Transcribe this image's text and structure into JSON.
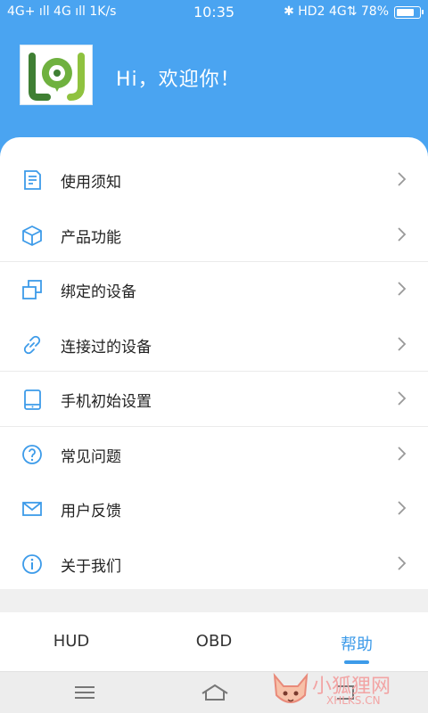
{
  "status_bar": {
    "left": "4G+ ıll 4G ıll 1K/s",
    "time": "10:35",
    "right": "✱ HD2 4G⇅ 78%",
    "battery_percent": 78
  },
  "header": {
    "greeting": "Hi，欢迎你！",
    "logo_icon": "app-logo-icon"
  },
  "menu": [
    {
      "label": "使用须知",
      "icon": "notice-doc-icon"
    },
    {
      "label": "产品功能",
      "icon": "cube-icon"
    },
    {
      "label": "绑定的设备",
      "icon": "bind-device-icon"
    },
    {
      "label": "连接过的设备",
      "icon": "link-icon"
    },
    {
      "label": "手机初始设置",
      "icon": "tablet-icon"
    },
    {
      "label": "常见问题",
      "icon": "question-icon"
    },
    {
      "label": "用户反馈",
      "icon": "mail-icon"
    },
    {
      "label": "关于我们",
      "icon": "info-icon"
    }
  ],
  "tabs": [
    {
      "label": "HUD",
      "active": false
    },
    {
      "label": "OBD",
      "active": false
    },
    {
      "label": "帮助",
      "active": true
    }
  ],
  "nav": {
    "menu_icon": "hamburger-icon",
    "home_icon": "home-icon",
    "back_icon": "back-icon"
  },
  "watermark": {
    "text": "小狐狸网",
    "sub": "XHLKS.CN"
  },
  "colors": {
    "primary": "#4aa4f1",
    "accent": "#3d9be9",
    "logo_green": "#6fb13f",
    "logo_dark": "#3f7f33"
  }
}
